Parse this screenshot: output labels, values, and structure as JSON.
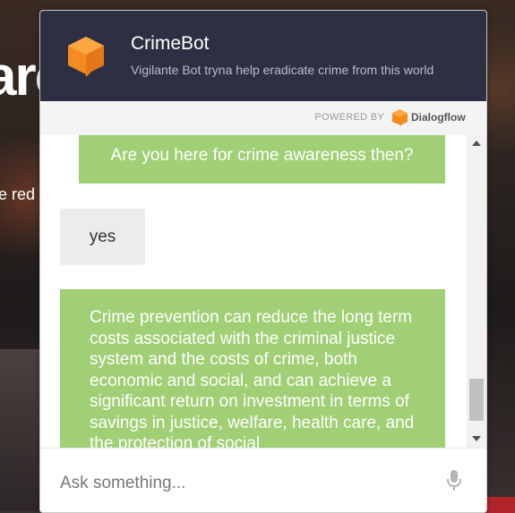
{
  "background": {
    "headline_fragment": "are",
    "text_fragment": "e red"
  },
  "header": {
    "bot_name": "CrimeBot",
    "bot_description": "Vigilante Bot tryna help eradicate crime from this world",
    "logo_icon": "speech-cube-icon",
    "accent_color": "#f58b1f",
    "header_color": "#2d3042"
  },
  "powered_by": {
    "label": "POWERED BY",
    "brand": "Dialogflow",
    "brand_icon": "dialogflow-icon"
  },
  "messages": [
    {
      "from": "bot",
      "text": "Are you here for crime awareness then?"
    },
    {
      "from": "user",
      "text": "yes"
    },
    {
      "from": "bot",
      "text": "Crime prevention can reduce the long term costs associated with the criminal justice system and the costs of crime, both economic and social, and can achieve a significant return on investment in terms of savings in justice, welfare, health care, and the protection of social"
    }
  ],
  "bubble_colors": {
    "bot": "#a1cf75",
    "user": "#ececec"
  },
  "input": {
    "placeholder": "Ask something...",
    "value": "",
    "mic_icon": "microphone-icon"
  }
}
